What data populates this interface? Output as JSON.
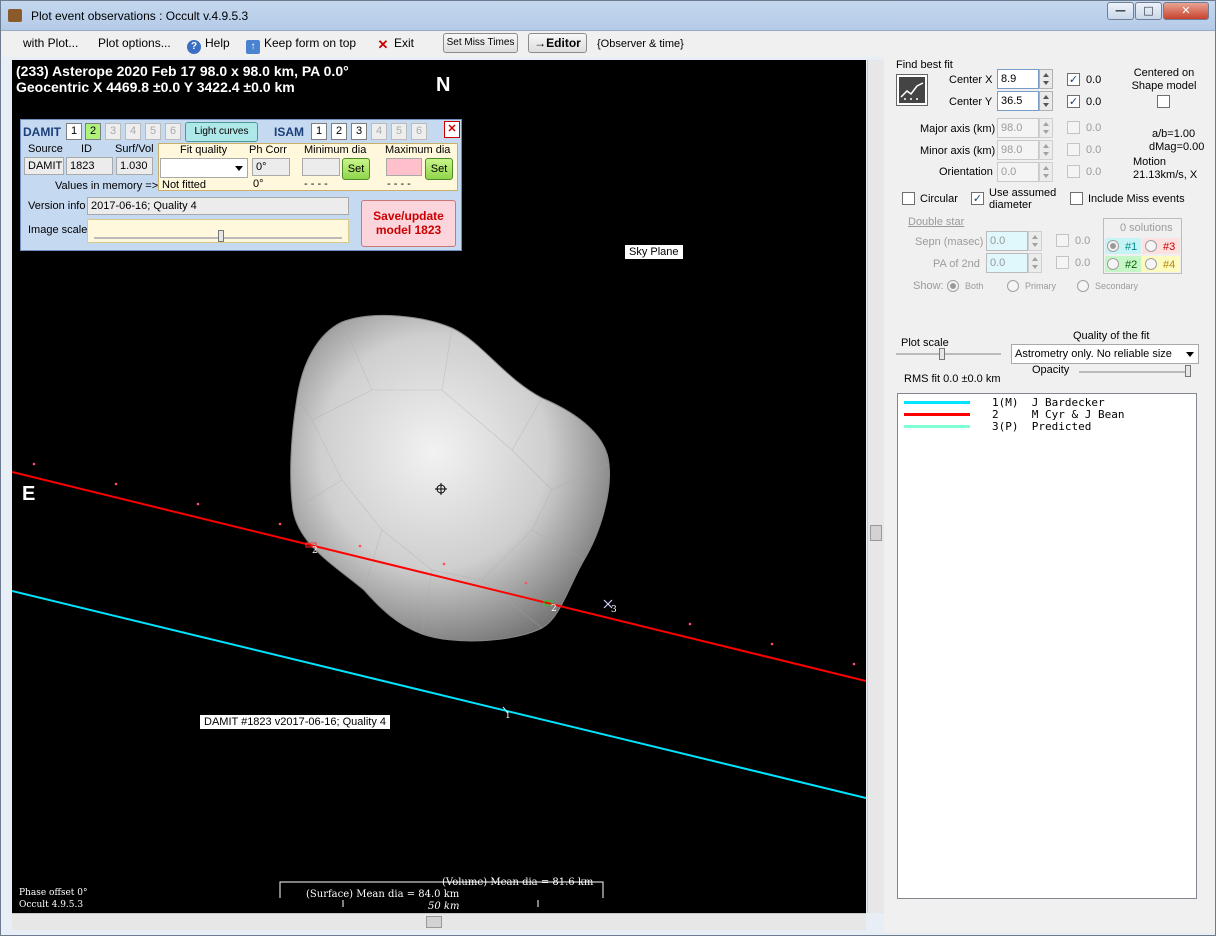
{
  "window": {
    "title": "Plot event observations : Occult v.4.9.5.3",
    "min": "—",
    "max": "□",
    "close": "✕"
  },
  "menu": {
    "with_plot": "with Plot...",
    "plot_options": "Plot options...",
    "help": "Help",
    "keep_on_top": "Keep form on top",
    "exit": "Exit",
    "set_miss_times": "Set Miss Times",
    "editor": "→Editor",
    "observer_time": "{Observer & time}"
  },
  "plot": {
    "header_line1": "(233) Asterope  2020 Feb 17   98.0 x 98.0 km, PA 0.0°",
    "header_line2": "Geocentric  X  4469.8 ±0.0  Y 3422.4 ±0.0 km",
    "north": "N",
    "east": "E",
    "sky_plane": "Sky Plane",
    "model_label": "DAMIT #1823 v2017-06-16; Quality 4",
    "chord_labels": [
      "2",
      "2",
      "3",
      "1"
    ],
    "volume_dia": "(Volume) Mean dia = 81.6 km",
    "surface_dia": "(Surface) Mean dia = 84.0 km",
    "scale_bar": "50 km",
    "phase_offset": "Phase offset 0°",
    "version": "Occult 4.9.5.3",
    "colors": {
      "chord1": "#00e5ff",
      "chord2": "#ff0000",
      "background": "#000000"
    }
  },
  "damit_panel": {
    "damit_label": "DAMIT",
    "damit_nums": [
      "1",
      "2",
      "3",
      "4",
      "5",
      "6"
    ],
    "light_curves": "Light curves",
    "isam_label": "ISAM",
    "isam_nums": [
      "1",
      "2",
      "3",
      "4",
      "5",
      "6"
    ],
    "close": "✕",
    "source_hdr": "Source",
    "id_hdr": "ID",
    "surfvol_hdr": "Surf/Vol",
    "source_val": "DAMIT",
    "id_val": "1823",
    "surfvol_val": "1.030",
    "values_in_memory": "Values in memory =>",
    "fit_quality_hdr": "Fit quality",
    "ph_corr_hdr": "Ph Corr",
    "min_dia_hdr": "Minimum dia",
    "max_dia_hdr": "Maximum dia",
    "ph_corr_val": "0°",
    "not_fitted": "Not fitted",
    "ph_corr_mem": "0°",
    "min_dash": "- - - -",
    "max_dash": "- - - -",
    "set": "Set",
    "version_info_lbl": "Version info",
    "version_info_val": "2017-06-16; Quality 4",
    "image_scale_lbl": "Image scale",
    "save_update": "Save/update model 1823"
  },
  "right_panel": {
    "find_best_fit": "Find best fit",
    "center_x_lbl": "Center X",
    "center_x_val": "8.9",
    "center_x_unc": "0.0",
    "center_y_lbl": "Center Y",
    "center_y_val": "36.5",
    "center_y_unc": "0.0",
    "centered_on": "Centered on Shape model",
    "major_lbl": "Major axis (km)",
    "major_val": "98.0",
    "major_unc": "0.0",
    "minor_lbl": "Minor axis (km)",
    "minor_val": "98.0",
    "minor_unc": "0.0",
    "orient_lbl": "Orientation",
    "orient_val": "0.0",
    "orient_unc": "0.0",
    "ab": "a/b=1.00",
    "dmag": "dMag=0.00",
    "motion_lbl": "Motion",
    "motion_val": "21.13km/s, X",
    "circular": "Circular",
    "use_assumed": "Use assumed diameter",
    "include_miss": "Include Miss events",
    "double_star": "Double star",
    "sepn_lbl": "Sepn (masec)",
    "sepn_val": "0.0",
    "sepn_unc": "0.0",
    "pa2_lbl": "PA of 2nd",
    "pa2_val": "0.0",
    "pa2_unc": "0.0",
    "show_lbl": "Show:",
    "show_both": "Both",
    "show_primary": "Primary",
    "show_secondary": "Secondary",
    "solutions": "0 solutions",
    "sol1": "#1",
    "sol2": "#2",
    "sol3": "#3",
    "sol4": "#4",
    "plot_scale": "Plot scale",
    "quality_fit": "Quality of the fit",
    "quality_val": "Astrometry only. No reliable size",
    "opacity": "Opacity",
    "rms_fit": "RMS fit 0.0 ±0.0 km"
  },
  "legend": [
    {
      "text": "1(M)  J Bardecker",
      "color": "#00e5ff"
    },
    {
      "text": "2     M Cyr & J Bean",
      "color": "#ff0000"
    },
    {
      "text": "3(P)  Predicted",
      "color": "#7fffd4"
    }
  ]
}
